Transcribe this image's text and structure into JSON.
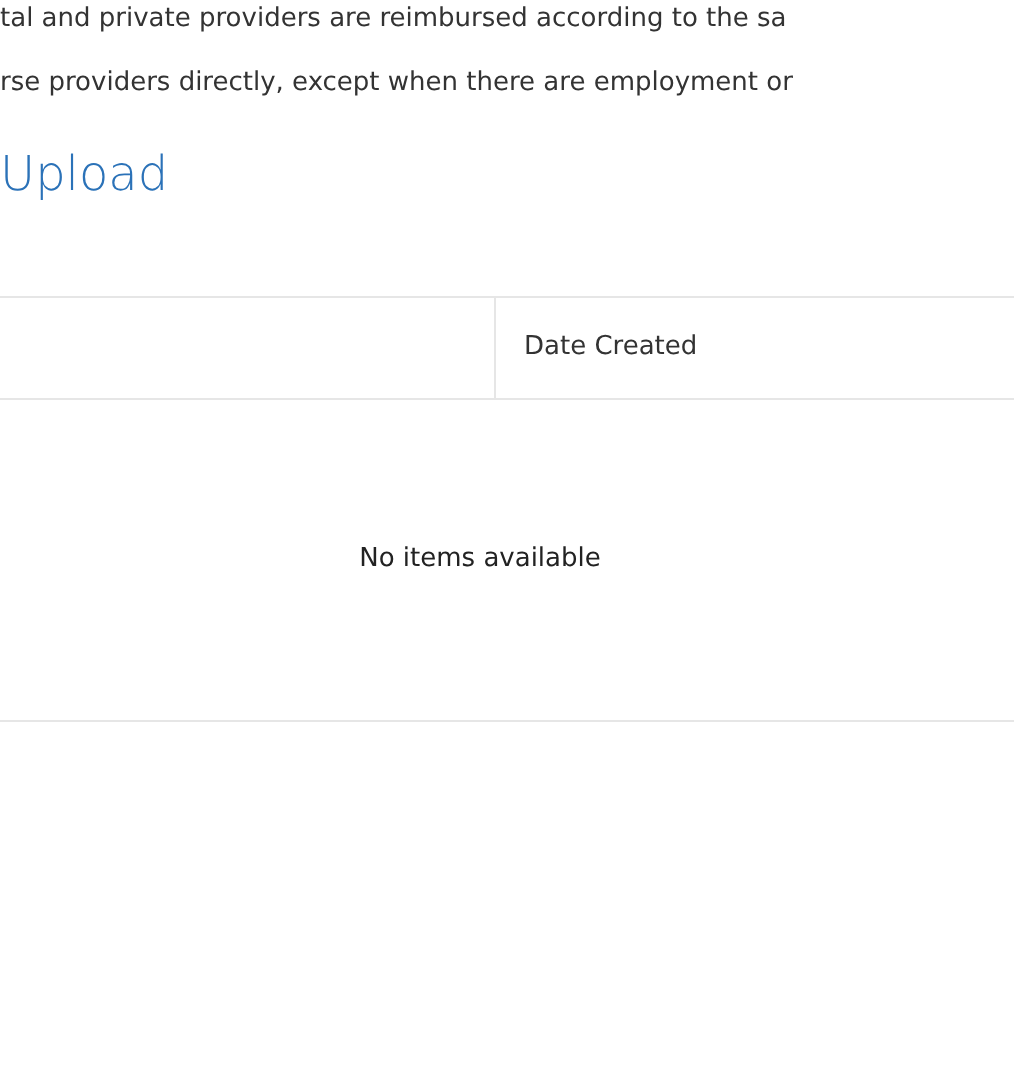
{
  "paragraph_lines": [
    "tal and private providers are reimbursed according to the sa",
    "rse providers directly, except when there are employment or"
  ],
  "section_title": "Upload",
  "table": {
    "columns": [
      "",
      "Date Created"
    ],
    "empty_message": "No items available"
  }
}
